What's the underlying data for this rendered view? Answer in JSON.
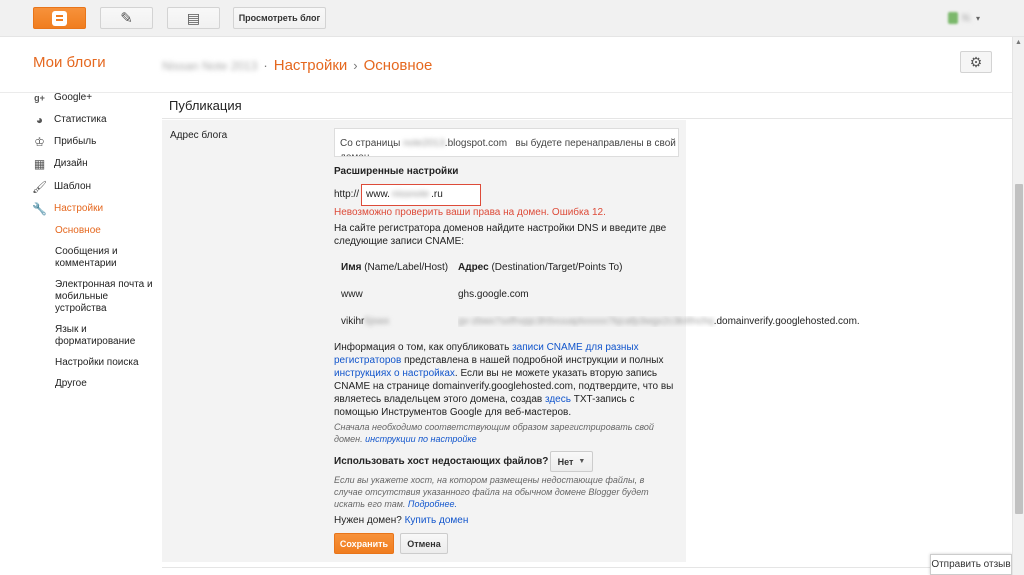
{
  "topbar": {
    "blogger_icon": "blogger-logo",
    "edit_icon": "pencil-icon",
    "posts_icon": "posts-icon",
    "view_blog_label": "Просмотреть блог",
    "account_caret": "▾"
  },
  "header": {
    "brand": "Мои блоги",
    "blog_name": "Nissan Note 2013",
    "crumb_sep1": "·",
    "crumb_settings": "Настройки",
    "crumb_sep2": "›",
    "crumb_basic": "Основное",
    "gear_icon": "gear-icon"
  },
  "sidebar": {
    "items": [
      {
        "label": "Google+",
        "icon": "google-plus-icon"
      },
      {
        "label": "Статистика",
        "icon": "stats-icon"
      },
      {
        "label": "Прибыль",
        "icon": "trophy-icon"
      },
      {
        "label": "Дизайн",
        "icon": "layout-icon"
      },
      {
        "label": "Шаблон",
        "icon": "template-icon"
      },
      {
        "label": "Настройки",
        "icon": "wrench-icon"
      }
    ],
    "subitems": [
      "Основное",
      "Сообщения и комментарии",
      "Электронная почта и мобильные устройства",
      "Язык и форматирование",
      "Настройки поиска",
      "Другое"
    ]
  },
  "main": {
    "section_title": "Публикация",
    "field_label": "Адрес блога",
    "redirect_prefix": "Со страницы",
    "redirect_blurred": "note2013",
    "redirect_domain": ".blogspot.com",
    "redirect_suffix": "вы будете перенаправлены в свой домен.",
    "advanced_title": "Расширенные настройки",
    "http_label": "http://",
    "domain_prefix": "www.",
    "domain_blurred": "nissnote",
    "domain_suffix": ".ru",
    "error": "Невозможно проверить ваши права на домен. Ошибка 12.",
    "instructions": "На сайте регистратора доменов найдите настройки DNS и введите две следующие записи CNAME:",
    "cname": {
      "name_head_bold": "Имя",
      "name_head_rest": "(Name/Label/Host)",
      "addr_head_bold": "Адрес",
      "addr_head_rest": "(Destination/Target/Points To)",
      "row1_name": "www",
      "row1_addr": "ghs.google.com",
      "row2_name_visible": "vikihr",
      "row2_name_blurred": "5jswx",
      "row2_addr_blurred": "gv-zbwx7sxfhvpjc3h5vuuaj4xxxxx7kjcafp3wgx2c3k4fnchq",
      "row2_addr_visible": ".domainverify.googlehosted.com."
    },
    "info_1": "Информация о том, как опубликовать ",
    "info_link1": "записи CNAME для разных регистраторов",
    "info_2": " представлена в нашей подробной инструкции и полных ",
    "info_link2": "инструкциях о настройках",
    "info_3": ". Если вы не можете указать вторую запись CNAME на странице domainverify.googlehosted.com, подтвердите, что вы являетесь владельцем этого домена, создав ",
    "info_link3": "здесь",
    "info_4": " TXT-запись с помощью Инструментов Google для веб-мастеров.",
    "note_text": "Сначала необходимо соответствующим образом зарегистрировать свой домен. ",
    "note_link": "инструкции по настройке",
    "missing_label": "Использовать хост недостающих файлов?",
    "missing_value": "Нет",
    "missing_note": "Если вы укажете хост, на котором размещены недостающие файлы, в случае отсутствия указанного файла на обычном домене Blogger будет искать его там. ",
    "missing_note_link": "Подробнее.",
    "need_domain": "Нужен домен? ",
    "buy_domain": "Купить домен",
    "save": "Сохранить",
    "cancel": "Отмена"
  },
  "feedback": "Отправить отзыв",
  "colors": {
    "accent": "#e5681f",
    "error": "#dd4b39",
    "link": "#1155cc"
  }
}
